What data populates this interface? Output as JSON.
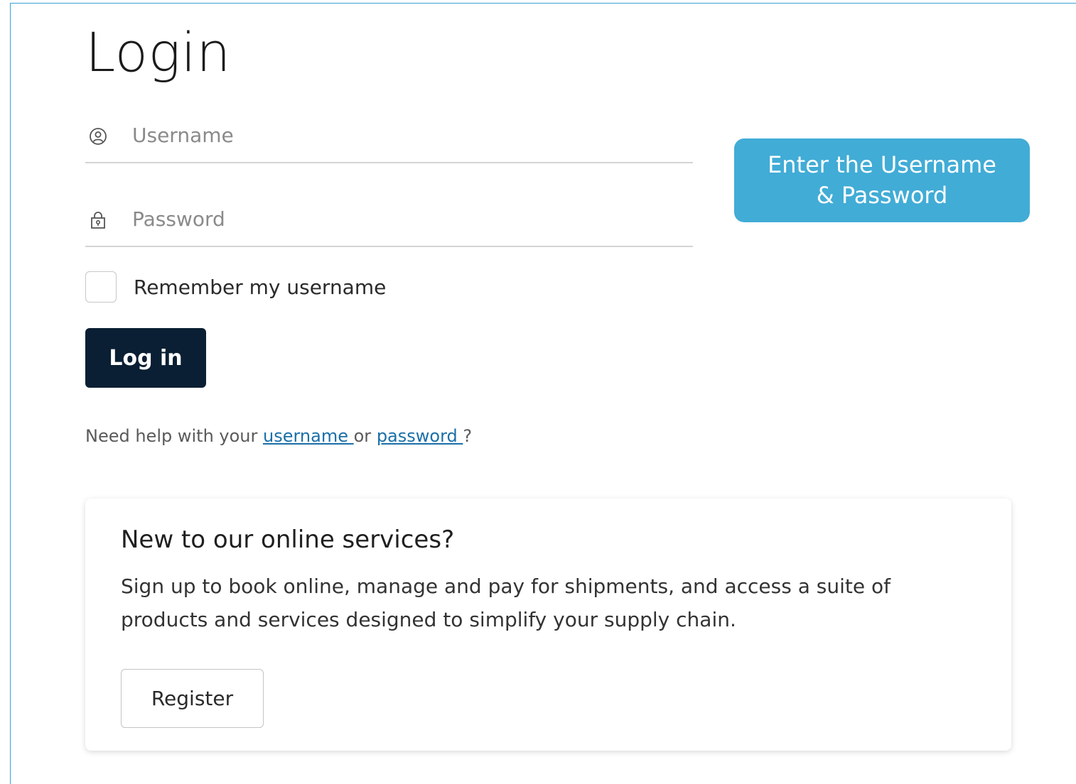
{
  "login": {
    "title": "Login",
    "username_placeholder": "Username",
    "username_icon": "user-circle-icon",
    "password_placeholder": "Password",
    "password_icon": "lock-icon",
    "remember_label": "Remember my username",
    "remember_checked": false,
    "login_button": "Log in",
    "help_prefix": "Need help with your ",
    "help_username_link": "username ",
    "help_or": " or ",
    "help_password_link": "password ",
    "help_suffix": "?"
  },
  "tooltip": {
    "line1": "Enter the Username",
    "line2": "& Password",
    "color": "#41acd6"
  },
  "register_card": {
    "title": "New to our online services?",
    "body": "Sign up to book online, manage and pay for shipments, and access a suite of products and services designed to simplify your supply chain.",
    "button": "Register"
  },
  "colors": {
    "primary_button": "#0a1f33",
    "link": "#1a6fa8",
    "frame_border": "#3aa0d6"
  }
}
